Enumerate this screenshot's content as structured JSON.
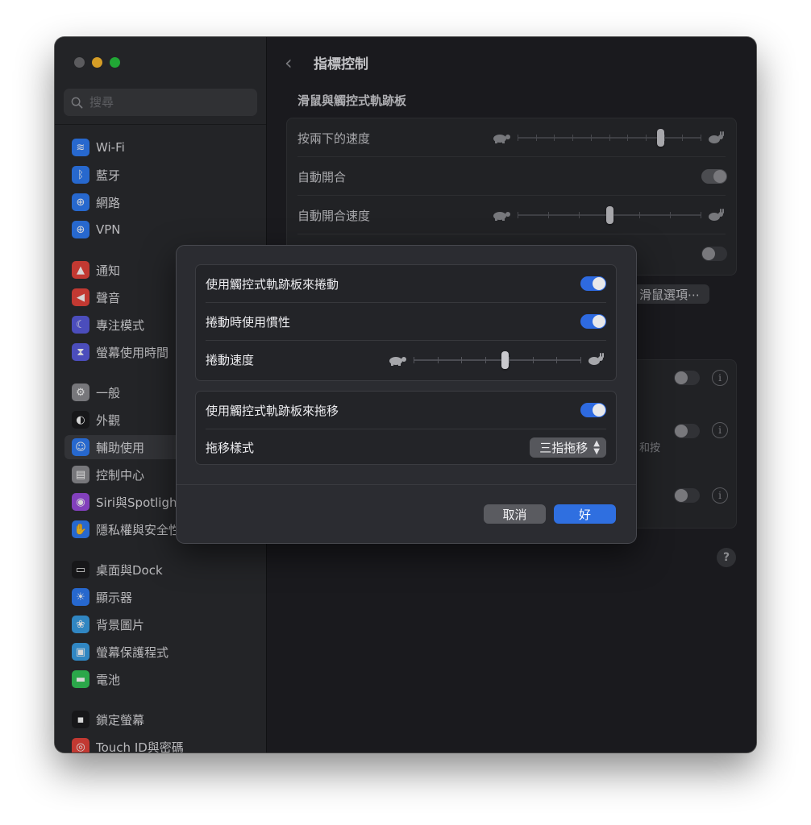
{
  "sidebar": {
    "search_placeholder": "搜尋",
    "groups": [
      [
        {
          "label": "Wi-Fi",
          "icon": "wifi-icon",
          "color": "#2f7cf6"
        },
        {
          "label": "藍牙",
          "icon": "bluetooth-icon",
          "color": "#2f7cf6"
        },
        {
          "label": "網路",
          "icon": "globe-icon",
          "color": "#2f7cf6"
        },
        {
          "label": "VPN",
          "icon": "vpn-globe-icon",
          "color": "#2f7cf6"
        }
      ],
      [
        {
          "label": "通知",
          "icon": "notification-bell-icon",
          "color": "#e8453c"
        },
        {
          "label": "聲音",
          "icon": "speaker-icon",
          "color": "#e8453c"
        },
        {
          "label": "專注模式",
          "icon": "moon-icon",
          "color": "#5a5ce0"
        },
        {
          "label": "螢幕使用時間",
          "icon": "hourglass-icon",
          "color": "#5a5ce0"
        }
      ],
      [
        {
          "label": "一般",
          "icon": "gear-icon",
          "color": "#8e8e93"
        },
        {
          "label": "外觀",
          "icon": "appearance-icon",
          "color": "#1c1c1e"
        },
        {
          "label": "輔助使用",
          "icon": "accessibility-icon",
          "color": "#2f7cf6",
          "selected": true
        },
        {
          "label": "控制中心",
          "icon": "control-center-icon",
          "color": "#8e8e93"
        },
        {
          "label": "Siri與Spotlight",
          "icon": "siri-icon",
          "color": "#9b4de0"
        },
        {
          "label": "隱私權與安全性",
          "icon": "hand-icon",
          "color": "#2f7cf6"
        }
      ],
      [
        {
          "label": "桌面與Dock",
          "icon": "dock-icon",
          "color": "#1c1c1e"
        },
        {
          "label": "顯示器",
          "icon": "brightness-icon",
          "color": "#2f7cf6"
        },
        {
          "label": "背景圖片",
          "icon": "wallpaper-icon",
          "color": "#3aa0e8"
        },
        {
          "label": "螢幕保護程式",
          "icon": "screensaver-icon",
          "color": "#3aa0e8"
        },
        {
          "label": "電池",
          "icon": "battery-icon",
          "color": "#34c759"
        }
      ],
      [
        {
          "label": "鎖定螢幕",
          "icon": "lock-icon",
          "color": "#1c1c1e"
        },
        {
          "label": "Touch ID與密碼",
          "icon": "fingerprint-icon",
          "color": "#e8453c"
        }
      ]
    ]
  },
  "main": {
    "back_icon": "chevron-left-icon",
    "title": "指標控制",
    "section_title": "滑鼠與觸控式軌跡板",
    "rows": {
      "double_click_speed": "按兩下的速度",
      "spring_loading": "自動開合",
      "spring_loading_speed": "自動開合速度"
    },
    "mouse_options_button": "滑鼠選項⋯",
    "partial_text": "和按",
    "help_label": "?"
  },
  "dialog": {
    "scroll_toggle_label": "使用觸控式軌跡板來捲動",
    "scroll_toggle_on": true,
    "inertia_label": "捲動時使用慣性",
    "inertia_on": true,
    "scroll_speed_label": "捲動速度",
    "scroll_speed": 0.55,
    "drag_toggle_label": "使用觸控式軌跡板來拖移",
    "drag_toggle_on": true,
    "drag_style_label": "拖移樣式",
    "drag_style_value": "三指拖移",
    "cancel_label": "取消",
    "ok_label": "好"
  },
  "sliders": {
    "double_click_speed": 0.79,
    "spring_loading_speed": 0.5
  },
  "colors": {
    "accent": "#2f6fe0",
    "window_bg": "#1f2024",
    "sidebar_bg": "#2a2b2f"
  }
}
